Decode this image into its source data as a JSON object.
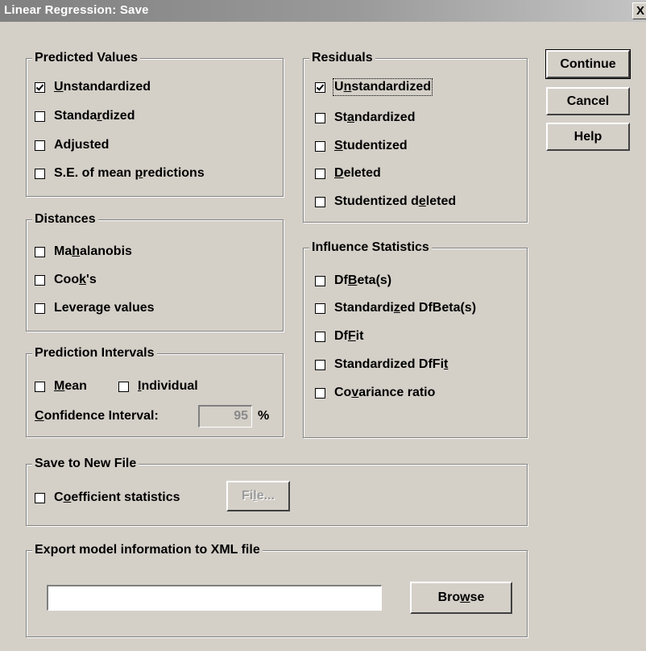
{
  "window": {
    "title": "Linear Regression: Save",
    "close_glyph": "X"
  },
  "predicted_values": {
    "title": "Predicted Values",
    "items": [
      {
        "pre": "",
        "key": "U",
        "post": "nstandardized",
        "checked": true
      },
      {
        "pre": "Standa",
        "key": "r",
        "post": "dized",
        "checked": false
      },
      {
        "pre": "Adjusted",
        "key": "",
        "post": "",
        "checked": false
      },
      {
        "pre": "S.E. of mean ",
        "key": "p",
        "post": "redictions",
        "checked": false
      }
    ]
  },
  "residuals": {
    "title": "Residuals",
    "items": [
      {
        "pre": "U",
        "key": "n",
        "post": "standardized",
        "checked": true
      },
      {
        "pre": "St",
        "key": "a",
        "post": "ndardized",
        "checked": false
      },
      {
        "pre": "",
        "key": "S",
        "post": "tudentized",
        "checked": false
      },
      {
        "pre": "",
        "key": "D",
        "post": "eleted",
        "checked": false
      },
      {
        "pre": "Studentized d",
        "key": "e",
        "post": "leted",
        "checked": false
      }
    ]
  },
  "distances": {
    "title": "Distances",
    "items": [
      {
        "pre": "Ma",
        "key": "h",
        "post": "alanobis",
        "checked": false
      },
      {
        "pre": "Coo",
        "key": "k",
        "post": "'s",
        "checked": false
      },
      {
        "pre": "Levera",
        "key": "g",
        "post": "e values",
        "checked": false
      }
    ]
  },
  "influence": {
    "title": "Influence Statistics",
    "items": [
      {
        "pre": "Df",
        "key": "B",
        "post": "eta(s)",
        "checked": false
      },
      {
        "pre": "Standardi",
        "key": "z",
        "post": "ed DfBeta(s)",
        "checked": false
      },
      {
        "pre": "Df",
        "key": "F",
        "post": "it",
        "checked": false
      },
      {
        "pre": "Standardized DfFi",
        "key": "t",
        "post": "",
        "checked": false
      },
      {
        "pre": "Co",
        "key": "v",
        "post": "ariance ratio",
        "checked": false
      }
    ]
  },
  "prediction_intervals": {
    "title": "Prediction Intervals",
    "mean": {
      "pre": "",
      "key": "M",
      "post": "ean",
      "checked": false
    },
    "individual": {
      "pre": "",
      "key": "I",
      "post": "ndividual",
      "checked": false
    },
    "ci_label": {
      "pre": "",
      "key": "C",
      "post": "onfidence Interval:"
    },
    "ci_value": "95",
    "ci_unit": "%"
  },
  "save_new_file": {
    "title": "Save to New File",
    "coef": {
      "pre": "C",
      "key": "o",
      "post": "efficient statistics",
      "checked": false
    },
    "file_button": {
      "pre": "Fi",
      "key": "l",
      "post": "e..."
    }
  },
  "export_xml": {
    "title": "Export model information to XML file",
    "path_value": "",
    "browse_button": {
      "pre": "Bro",
      "key": "w",
      "post": "se"
    }
  },
  "buttons": {
    "continue": "Continue",
    "cancel": "Cancel",
    "help": "Help"
  }
}
